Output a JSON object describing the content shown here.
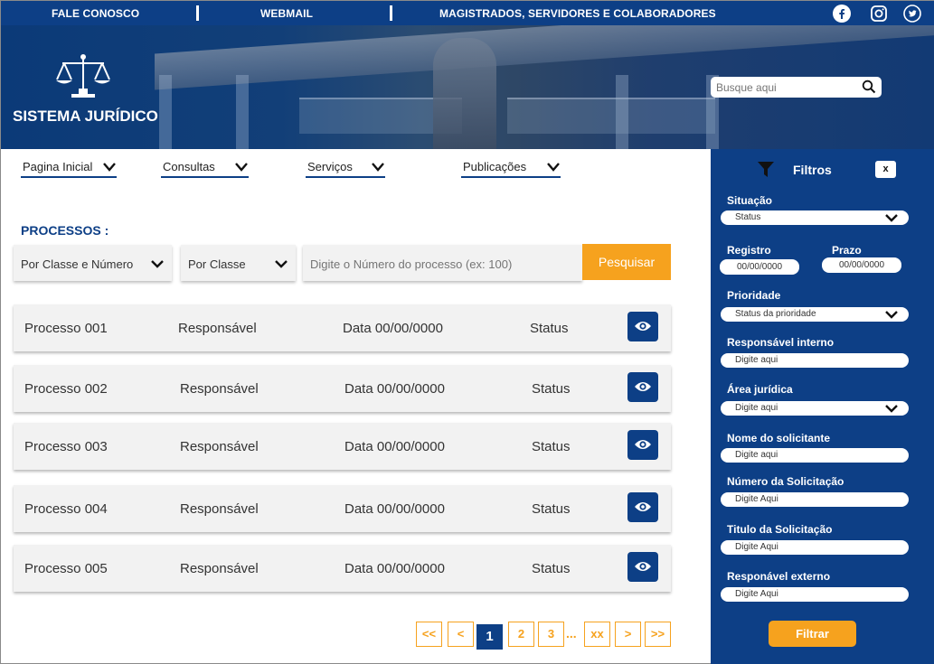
{
  "topbar": {
    "links": [
      "FALE CONOSCO",
      "WEBMAIL",
      "MAGISTRADOS, SERVIDORES E COLABORADORES"
    ],
    "social_icons": [
      "facebook-icon",
      "instagram-icon",
      "twitter-icon"
    ]
  },
  "header": {
    "brand": "SISTEMA JURÍDICO",
    "search_placeholder": "Busque aqui"
  },
  "nav": {
    "items": [
      "Pagina Inicial",
      "Consultas",
      "Serviços",
      "Publicações"
    ]
  },
  "processos": {
    "title": "PROCESSOS :",
    "filter1": "Por Classe e Número",
    "filter2": "Por Classe",
    "number_placeholder": "Digite o Número do processo (ex: 100)",
    "search_button": "Pesquisar",
    "rows": [
      {
        "name": "Processo 001",
        "resp": "Responsável",
        "date": "Data 00/00/0000",
        "status": "Status"
      },
      {
        "name": "Processo 002",
        "resp": "Responsável",
        "date": "Data 00/00/0000",
        "status": "Status"
      },
      {
        "name": "Processo 003",
        "resp": "Responsável",
        "date": "Data 00/00/0000",
        "status": "Status"
      },
      {
        "name": "Processo 004",
        "resp": "Responsável",
        "date": "Data 00/00/0000",
        "status": "Status"
      },
      {
        "name": "Processo 005",
        "resp": "Responsável",
        "date": "Data 00/00/0000",
        "status": "Status"
      }
    ]
  },
  "pagination": {
    "first": "<<",
    "prev": "<",
    "pages": [
      "1",
      "2",
      "3"
    ],
    "dots": "...",
    "last_page": "xx",
    "next": ">",
    "last": ">>"
  },
  "filters": {
    "title": "Filtros",
    "close": "x",
    "situacao_label": "Situação",
    "situacao_value": "Status",
    "registro_label": "Registro",
    "registro_value": "00/00/0000",
    "prazo_label": "Prazo",
    "prazo_value": "00/00/0000",
    "prioridade_label": "Prioridade",
    "prioridade_value": "Status da prioridade",
    "resp_interno_label": "Responsável interno",
    "resp_interno_value": "Digite aqui",
    "area_label": "Área jurídica",
    "area_value": "Digite aqui",
    "nome_label": "Nome do solicitante",
    "nome_value": "Digite aqui",
    "numero_label": "Número da Solicitação",
    "numero_value": "Digite Aqui",
    "titulo_label": "Titulo da Solicitação",
    "titulo_value": "Digite Aqui",
    "resp_externo_label": "Responável externo",
    "resp_externo_value": "Digite Aqui",
    "button": "Filtrar"
  },
  "colors": {
    "primary": "#0d3f86",
    "accent": "#f6a21e"
  }
}
